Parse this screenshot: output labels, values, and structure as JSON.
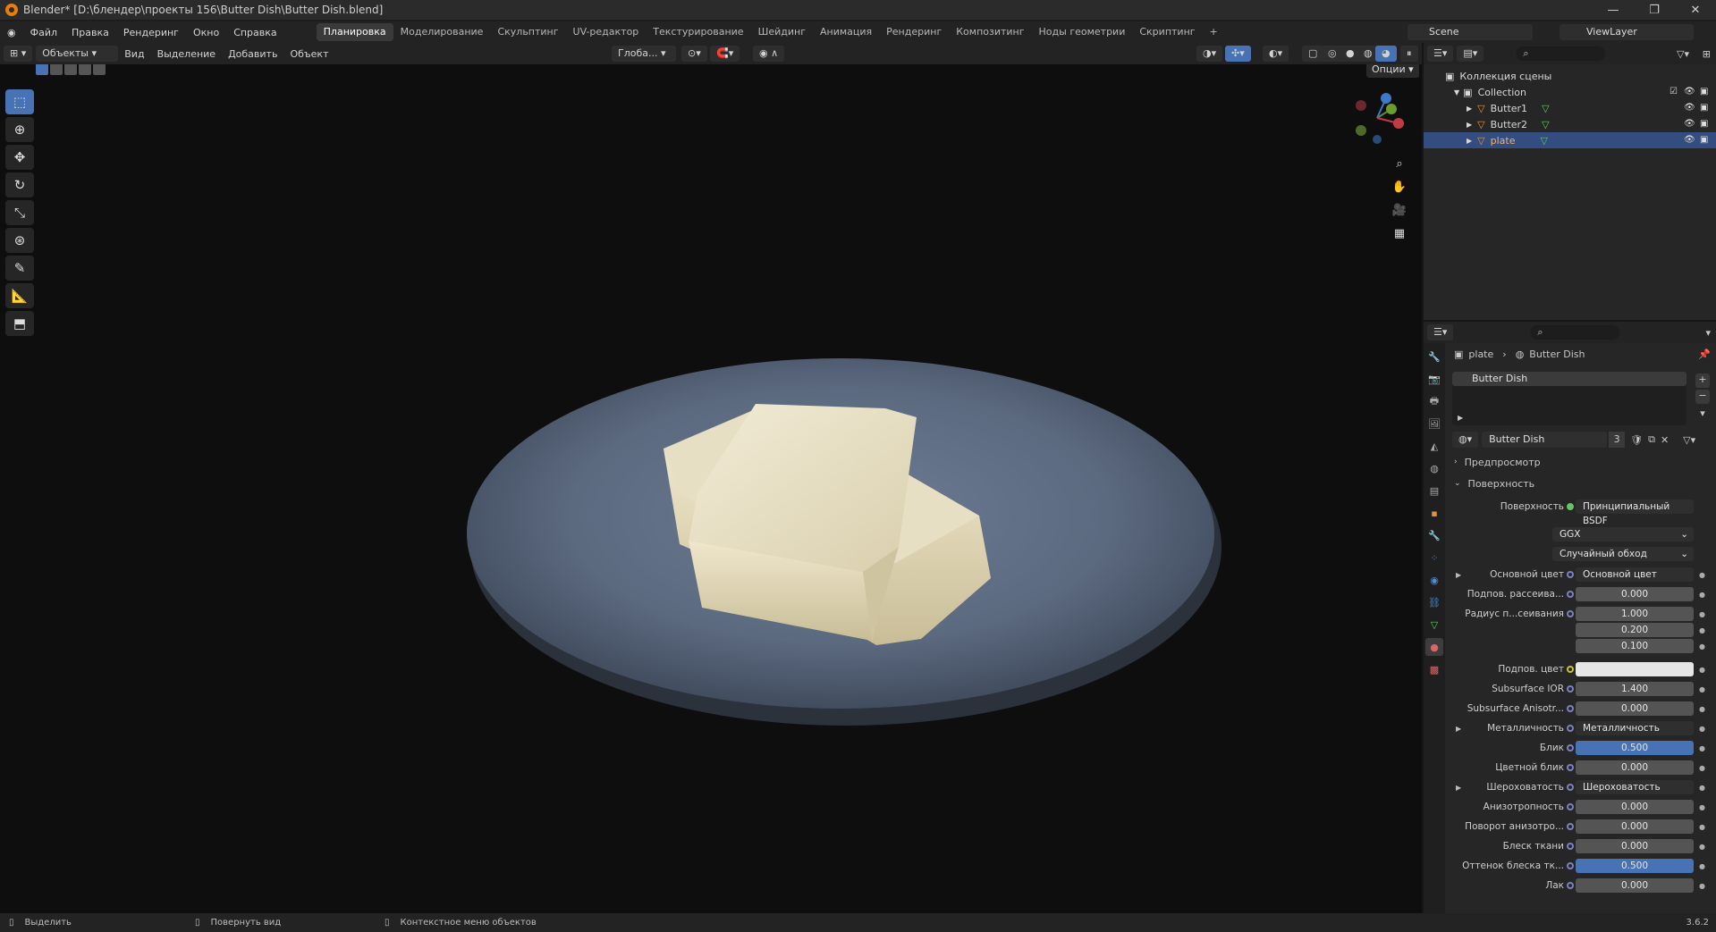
{
  "titlebar": {
    "title": "Blender* [D:\\блендер\\проекты 156\\Butter Dish\\Butter Dish.blend]"
  },
  "menu": [
    "Файл",
    "Правка",
    "Рендеринг",
    "Окно",
    "Справка"
  ],
  "workspaces": [
    "Планировка",
    "Моделирование",
    "Скульптинг",
    "UV-редактор",
    "Текстурирование",
    "Шейдинг",
    "Анимация",
    "Рендеринг",
    "Композитинг",
    "Ноды геометрии",
    "Скриптинг"
  ],
  "scene": {
    "scene_label": "Scene",
    "view_layer_label": "ViewLayer"
  },
  "viewport_header": {
    "mode": "Объекты",
    "menus": [
      "Вид",
      "Выделение",
      "Добавить",
      "Объект"
    ],
    "orientation": "Глоба...",
    "options": "Опции"
  },
  "outliner": {
    "root": "Коллекция сцены",
    "collection": "Collection",
    "objects": [
      {
        "name": "Butter1",
        "selected": false
      },
      {
        "name": "Butter2",
        "selected": false
      },
      {
        "name": "plate",
        "selected": true
      }
    ]
  },
  "properties": {
    "breadcrumb": {
      "object": "plate",
      "material": "Butter Dish"
    },
    "slot": "Butter Dish",
    "material_name": "Butter Dish",
    "user_count": "3",
    "panels": {
      "preview": "Предпросмотр",
      "surface": "Поверхность"
    },
    "surface_label": "Поверхность",
    "surface_value": "Принципиальный BSDF",
    "distribution": "GGX",
    "subsurface_method": "Случайный обход",
    "rows": [
      {
        "label": "Основной цвет",
        "value": "Основной цвет",
        "type": "link"
      },
      {
        "label": "Подпов. рассеива...",
        "value": "0.000",
        "type": "num"
      },
      {
        "label": "Радиус п...сеивания",
        "value": "1.000",
        "type": "num"
      },
      {
        "label": "",
        "value": "0.200",
        "type": "num"
      },
      {
        "label": "",
        "value": "0.100",
        "type": "num"
      },
      {
        "label": "Подпов. цвет",
        "value": "",
        "type": "color"
      },
      {
        "label": "Subsurface IOR",
        "value": "1.400",
        "type": "num"
      },
      {
        "label": "Subsurface Anisotr...",
        "value": "0.000",
        "type": "num"
      },
      {
        "label": "Металличность",
        "value": "Металличность",
        "type": "link"
      },
      {
        "label": "Блик",
        "value": "0.500",
        "type": "blue"
      },
      {
        "label": "Цветной блик",
        "value": "0.000",
        "type": "num"
      },
      {
        "label": "Шероховатость",
        "value": "Шероховатость",
        "type": "link"
      },
      {
        "label": "Анизотропность",
        "value": "0.000",
        "type": "num"
      },
      {
        "label": "Поворот анизотро...",
        "value": "0.000",
        "type": "num"
      },
      {
        "label": "Блеск ткани",
        "value": "0.000",
        "type": "num"
      },
      {
        "label": "Оттенок блеска тк...",
        "value": "0.500",
        "type": "blue"
      },
      {
        "label": "Лак",
        "value": "0.000",
        "type": "num"
      }
    ]
  },
  "statusbar": {
    "select": "Выделить",
    "rotate": "Повернуть вид",
    "context": "Контекстное меню объектов",
    "version": "3.6.2"
  },
  "colors": {
    "accent": "#4772b3",
    "selection": "#334d80",
    "background": "#0e0e0e"
  }
}
